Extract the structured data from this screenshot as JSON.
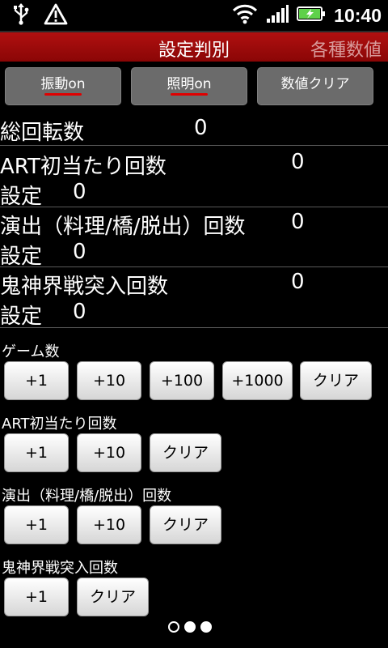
{
  "statusbar": {
    "icons_left": [
      "usb-icon",
      "warning-icon"
    ],
    "icons_right": [
      "wifi-icon",
      "signal-icon",
      "battery-charging-icon"
    ],
    "time": "10:40"
  },
  "titlebar": {
    "title": "設定判別",
    "next_tab": "各種数値"
  },
  "top_buttons": [
    {
      "label": "振動on",
      "underline": true
    },
    {
      "label": "照明on",
      "underline": true
    },
    {
      "label": "数値クリア",
      "underline": false
    }
  ],
  "counters": {
    "total_spins": {
      "label": "総回転数",
      "value": "0"
    },
    "art": {
      "label": "ART初当たり回数",
      "value": "0",
      "setting_label": "設定",
      "setting_value": "0"
    },
    "performance": {
      "label": "演出（料理/橋/脱出）回数",
      "value": "0",
      "setting_label": "設定",
      "setting_value": "0"
    },
    "kishin": {
      "label": "鬼神界戦突入回数",
      "value": "0",
      "setting_label": "設定",
      "setting_value": "0"
    }
  },
  "sections": {
    "games": {
      "label": "ゲーム数",
      "buttons": [
        "+1",
        "+10",
        "+100",
        "+1000",
        "クリア"
      ]
    },
    "art": {
      "label": "ART初当たり回数",
      "buttons": [
        "+1",
        "+10",
        "クリア"
      ]
    },
    "performance": {
      "label": "演出（料理/橋/脱出）回数",
      "buttons": [
        "+1",
        "+10",
        "クリア"
      ]
    },
    "kishin": {
      "label": "鬼神界戦突入回数",
      "buttons": [
        "+1",
        "クリア"
      ]
    }
  },
  "page_indicator": {
    "total": 3,
    "current": 1
  },
  "colors": {
    "accent_red": "#b01010",
    "underline_red": "#e00000"
  }
}
